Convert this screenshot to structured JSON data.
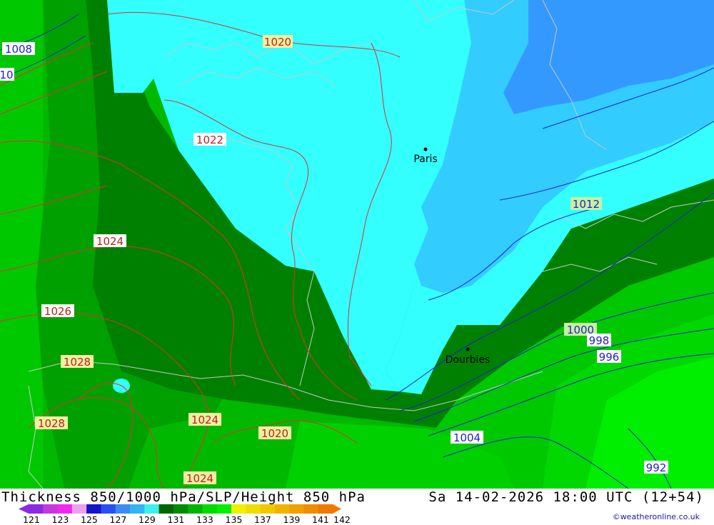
{
  "title": "Thickness 850/1000 hPa/SLP/Height 850 hPa",
  "valid_time": "Sa 14-02-2026 18:00 UTC (12+54)",
  "credit": "©weatheronline.co.uk",
  "places": [
    {
      "name": "Paris"
    },
    {
      "name": "Dourbies"
    }
  ],
  "isobar_labels_red": [
    "1020",
    "1022",
    "1024",
    "1026",
    "1028",
    "1028",
    "1024",
    "1020",
    "1024"
  ],
  "isobar_labels_blue": [
    "1008",
    "10",
    "1012",
    "1000",
    "998",
    "996",
    "1004",
    "992"
  ],
  "colorbar": {
    "ticks": [
      "121",
      "123",
      "125",
      "127",
      "129",
      "131",
      "133",
      "135",
      "137",
      "139",
      "141",
      "142"
    ],
    "colors": [
      "#8a2be2",
      "#c838d8",
      "#f028f0",
      "#f0a0f0",
      "#1414c8",
      "#2850f0",
      "#3c8cf0",
      "#32b4f0",
      "#3cf0f0",
      "#006400",
      "#008c00",
      "#00b400",
      "#00dc00",
      "#00f000",
      "#f0f000",
      "#f0dc00",
      "#f0c800",
      "#f0b400",
      "#f0a000",
      "#f08c00",
      "#f07800"
    ]
  },
  "palette": {
    "dark_green": "#008000",
    "mid_green": "#00a600",
    "bright_green": "#00d200",
    "light_green": "#00f000",
    "cyan": "#33ffff",
    "sky_blue": "#33ccff",
    "blue": "#3399ff",
    "isobar_red": "#e03030",
    "isobar_blue": "#2020d0",
    "border_gray": "#c0c0c0"
  }
}
